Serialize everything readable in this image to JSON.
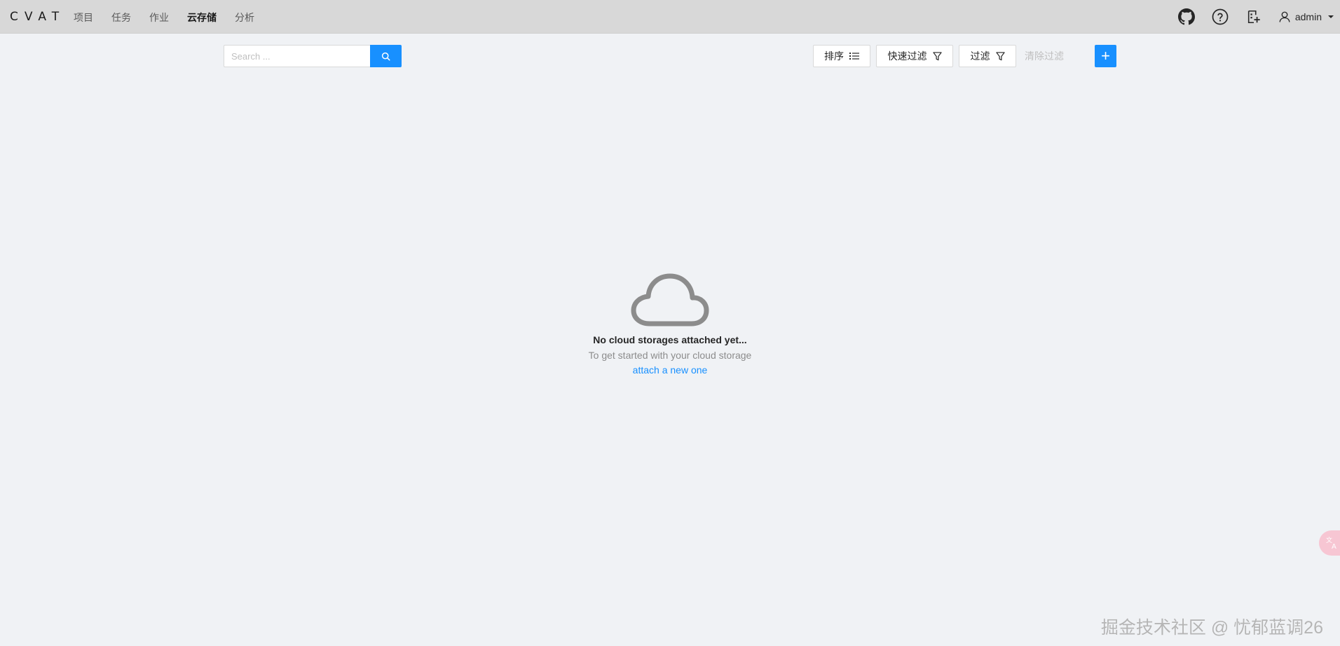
{
  "header": {
    "logo": "CVAT",
    "nav": [
      "项目",
      "任务",
      "作业",
      "云存储",
      "分析"
    ],
    "user": "admin"
  },
  "toolbar": {
    "search_placeholder": "Search ...",
    "sort_label": "排序",
    "quick_filter_label": "快速过滤",
    "filter_label": "过滤",
    "clear_filter_label": "清除过滤",
    "add_label": "+"
  },
  "empty_state": {
    "title": "No cloud storages attached yet...",
    "subtitle": "To get started with your cloud storage",
    "link": "attach a new one"
  },
  "watermark": "掘金技术社区 @ 忧郁蓝调26",
  "colors": {
    "primary": "#1890ff",
    "header_bg": "#d8d8d8",
    "page_bg": "#f0f2f5",
    "empty_icon": "#8c8c8c"
  },
  "icons": {
    "header": [
      "github-icon",
      "help-icon",
      "organization-icon",
      "user-icon",
      "caret-down-icon"
    ],
    "toolbar": [
      "search-icon",
      "sort-list-icon",
      "filter-icon"
    ],
    "empty": "cloud-icon",
    "badge": "translate-icon"
  }
}
